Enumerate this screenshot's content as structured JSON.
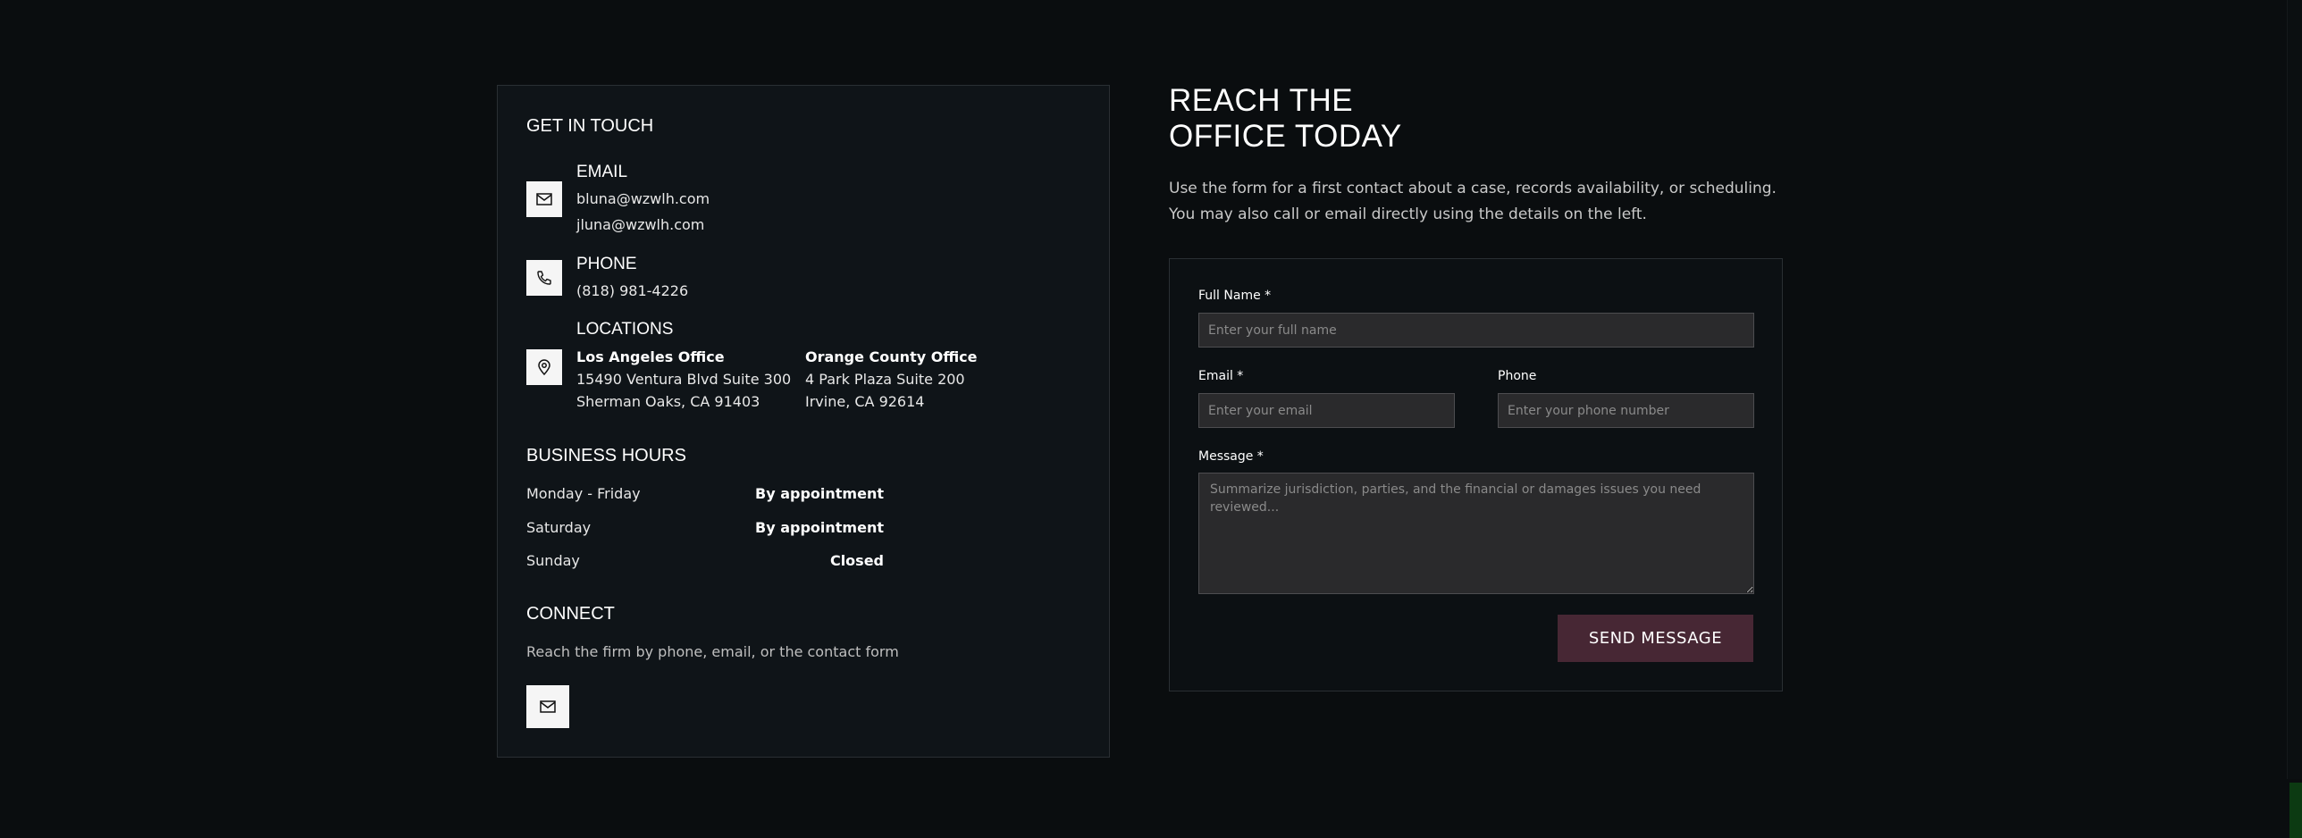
{
  "contact": {
    "title": "GET IN TOUCH",
    "email": {
      "label": "EMAIL",
      "addresses": [
        "bluna@wzwlh.com",
        "jluna@wzwlh.com"
      ],
      "icon": "mail-icon"
    },
    "phone": {
      "label": "PHONE",
      "number": "(818) 981-4226",
      "icon": "phone-icon"
    },
    "locations": {
      "label": "LOCATIONS",
      "icon": "map-pin-icon",
      "offices": [
        {
          "name": "Los Angeles Office",
          "line1": "15490 Ventura Blvd Suite 300",
          "line2": "Sherman Oaks, CA 91403"
        },
        {
          "name": "Orange County Office",
          "line1": "4 Park Plaza Suite 200",
          "line2": "Irvine, CA 92614"
        }
      ]
    }
  },
  "hours": {
    "title": "BUSINESS HOURS",
    "rows": [
      {
        "day": "Monday - Friday",
        "value": "By appointment"
      },
      {
        "day": "Saturday",
        "value": "By appointment"
      },
      {
        "day": "Sunday",
        "value": "Closed"
      }
    ]
  },
  "connect": {
    "title": "CONNECT",
    "text": "Reach the firm by phone, email, or the contact form",
    "icon": "mail-icon"
  },
  "hero": {
    "line1": "REACH THE",
    "line2": "OFFICE TODAY",
    "intro": "Use the form for a first contact about a case, records availability, or scheduling. You may also call or email directly using the details on the left."
  },
  "form": {
    "name_label": "Full Name *",
    "name_placeholder": "Enter your full name",
    "email_label": "Email *",
    "email_placeholder": "Enter your email",
    "phone_label": "Phone",
    "phone_placeholder": "Enter your phone number",
    "message_label": "Message *",
    "message_placeholder": "Summarize jurisdiction, parties, and the financial or damages issues you need reviewed...",
    "submit_label": "SEND MESSAGE"
  },
  "colors": {
    "background": "#0a0d0f",
    "card": "#0f1418",
    "button": "#472734"
  }
}
